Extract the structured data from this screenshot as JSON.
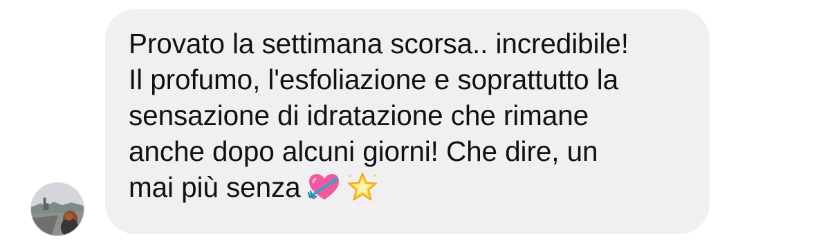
{
  "comment": {
    "text": "Provato la settimana scorsa.. incredibile!\nIl profumo, l'esfoliazione e soprattutto la\nsensazione di idratazione che rimane\nanche dopo alcuni giorni! Che dire, un\nmai più senza",
    "emojis": [
      "heart-with-arrow-icon",
      "glowing-star-icon"
    ]
  },
  "avatar": {
    "icon": "user-avatar-photo"
  },
  "colors": {
    "bubble": "#f0f0f2",
    "text": "#111111",
    "background": "#ffffff"
  }
}
